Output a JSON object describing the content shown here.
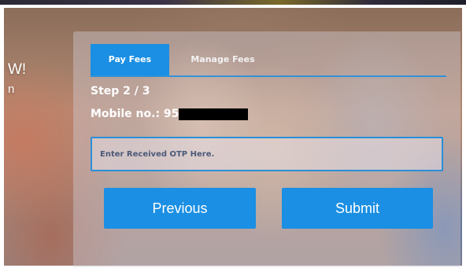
{
  "hero": {
    "title_fragment": "W!",
    "subtitle_fragment": "n"
  },
  "tabs": [
    {
      "label": "Pay Fees",
      "active": true
    },
    {
      "label": "Manage Fees",
      "active": false
    }
  ],
  "form": {
    "step_text": "Step 2 / 3",
    "mobile_label": "Mobile no.: 95",
    "otp_placeholder": "Enter Received OTP Here.",
    "otp_value": ""
  },
  "buttons": {
    "previous_label": "Previous",
    "submit_label": "Submit"
  },
  "colors": {
    "accent": "#1a8fe3",
    "text_on_accent": "#ffffff"
  }
}
